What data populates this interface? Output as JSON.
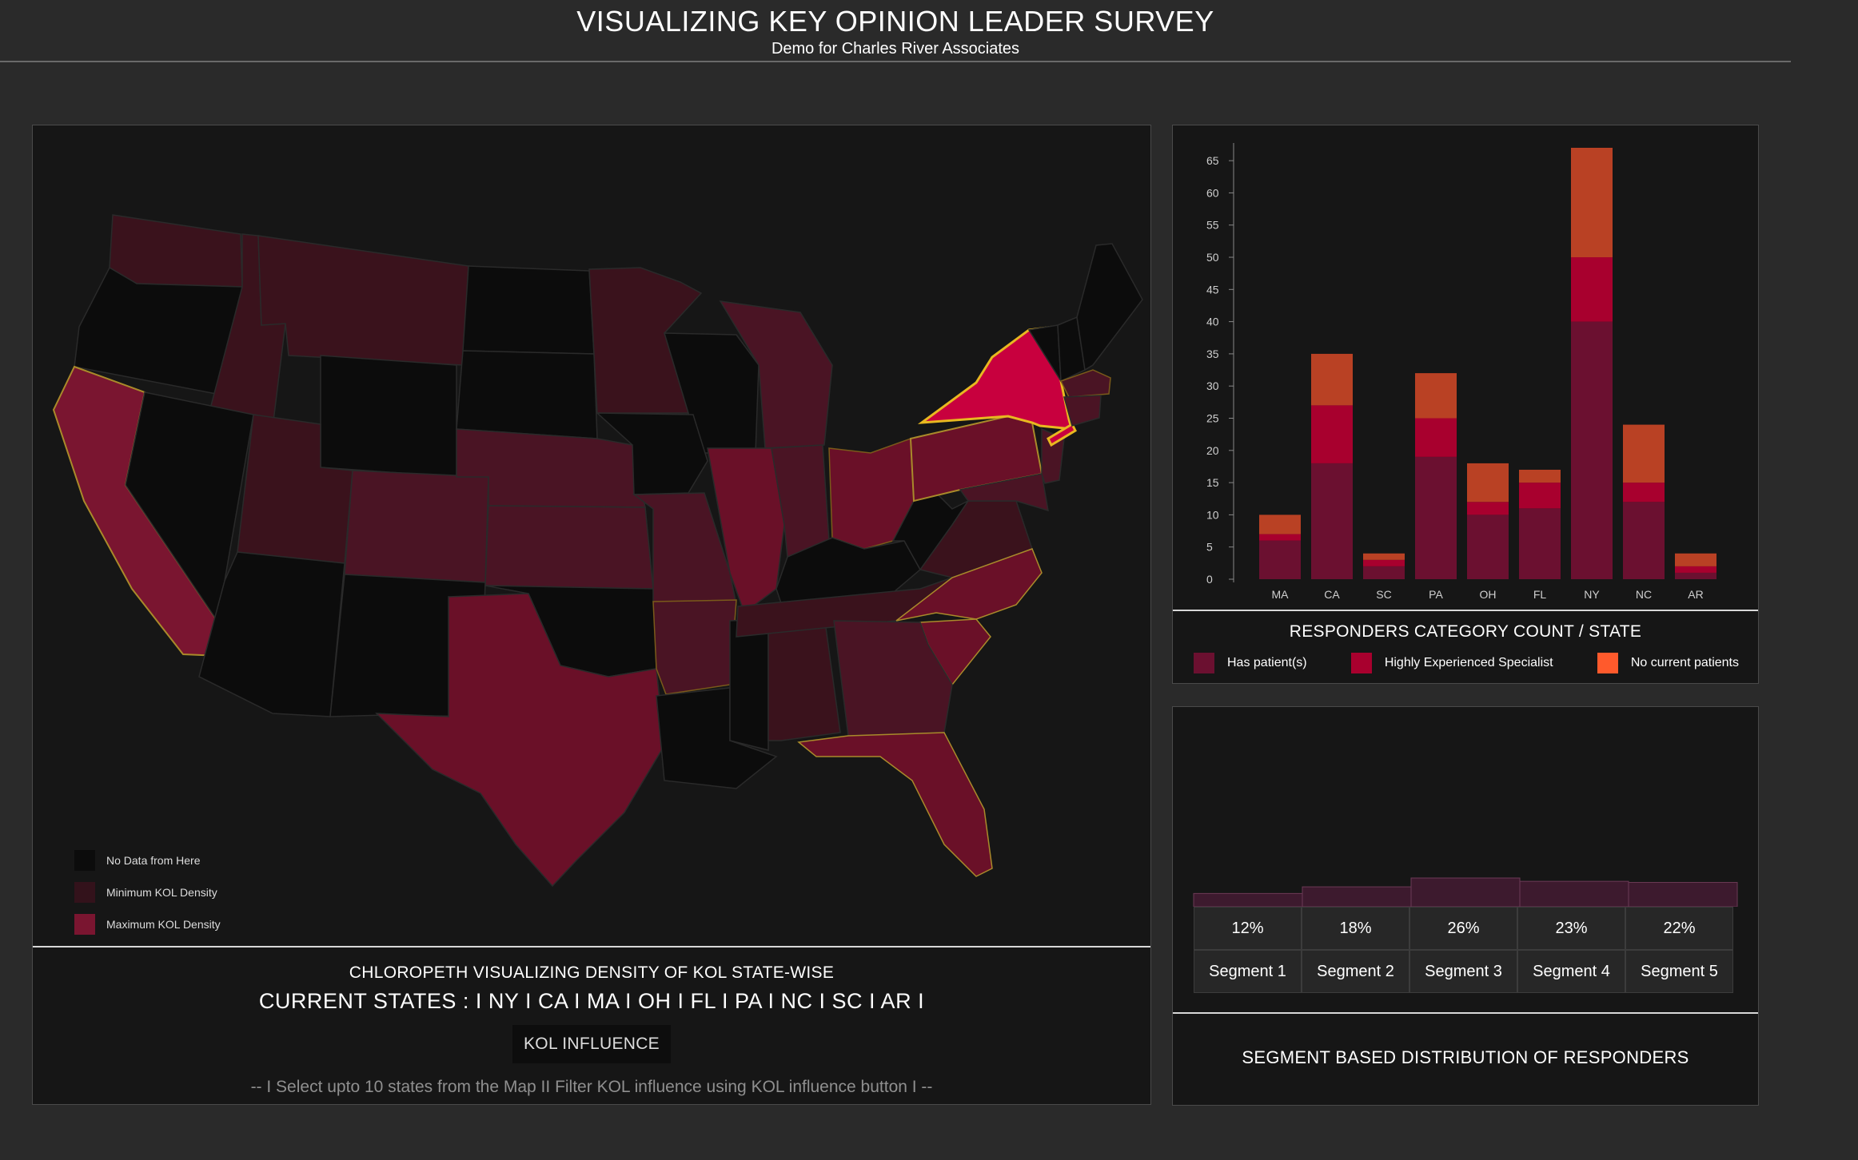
{
  "header": {
    "title": "VISUALIZING KEY OPINION LEADER SURVEY",
    "subtitle": "Demo for Charles River Associates"
  },
  "map": {
    "legend": [
      {
        "label": "No Data from Here",
        "color": "#0c0c0c"
      },
      {
        "label": "Minimum KOL Density",
        "color": "#33121b"
      },
      {
        "label": "Maximum KOL Density",
        "color": "#7a1530"
      }
    ],
    "footer": {
      "title": "CHLOROPETH VISUALIZING DENSITY OF KOL STATE-WISE",
      "current_states": "CURRENT STATES : I NY I CA I MA I OH I FL I PA I NC I SC I AR I",
      "kol_button": "KOL INFLUENCE",
      "hint": "-- I Select upto 10 states from the Map II Filter KOL influence using KOL influence button I --"
    }
  },
  "bar_panel": {
    "caption": "RESPONDERS CATEGORY COUNT / STATE",
    "legend": [
      {
        "label": "Has patient(s)",
        "color": "#6b1030"
      },
      {
        "label": "Highly Experienced Specialist",
        "color": "#a8002e"
      },
      {
        "label": "No current patients",
        "color": "#ff5a2c"
      }
    ]
  },
  "chart_data": {
    "type": "bar",
    "stacked": true,
    "categories": [
      "MA",
      "CA",
      "SC",
      "PA",
      "OH",
      "FL",
      "NY",
      "NC",
      "AR"
    ],
    "series": [
      {
        "name": "Has patient(s)",
        "values": [
          6,
          18,
          2,
          19,
          10,
          11,
          40,
          12,
          1
        ]
      },
      {
        "name": "Highly Experienced Specialist",
        "values": [
          1,
          9,
          1,
          6,
          2,
          4,
          10,
          3,
          1
        ]
      },
      {
        "name": "No current patients",
        "values": [
          3,
          8,
          1,
          7,
          6,
          2,
          17,
          9,
          2
        ]
      }
    ],
    "colors": [
      "#6b1030",
      "#a8002e",
      "#b94124"
    ],
    "title": "RESPONDERS CATEGORY COUNT / STATE",
    "xlabel": "",
    "ylabel": "",
    "yticks": [
      0,
      5,
      10,
      15,
      20,
      25,
      30,
      35,
      40,
      45,
      50,
      55,
      60,
      65
    ],
    "ylim": [
      0,
      67
    ],
    "grid": false
  },
  "segments": {
    "caption": "SEGMENT BASED DISTRIBUTION OF RESPONDERS",
    "items": [
      {
        "label": "Segment 1",
        "pct": "12%",
        "value": 12
      },
      {
        "label": "Segment 2",
        "pct": "18%",
        "value": 18
      },
      {
        "label": "Segment 3",
        "pct": "26%",
        "value": 26
      },
      {
        "label": "Segment 4",
        "pct": "23%",
        "value": 23
      },
      {
        "label": "Segment 5",
        "pct": "22%",
        "value": 22
      }
    ]
  }
}
